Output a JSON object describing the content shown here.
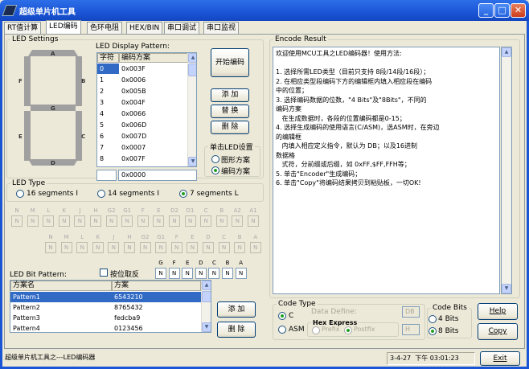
{
  "window": {
    "title": "超级单片机工具"
  },
  "tabs": [
    {
      "label": "RT值计算"
    },
    {
      "label": "LED编码"
    },
    {
      "label": "色环电阻"
    },
    {
      "label": "HEX/BIN"
    },
    {
      "label": "串口调试"
    },
    {
      "label": "串口监视"
    }
  ],
  "led_settings": {
    "legend": "LED Settings",
    "segments": [
      "A",
      "F",
      "B",
      "G",
      "E",
      "C",
      "D"
    ]
  },
  "display_pattern": {
    "legend": "LED Display Pattern:",
    "columns": [
      "字符",
      "编码方案"
    ],
    "rows": [
      {
        "char": "0",
        "code": "0x003F"
      },
      {
        "char": "1",
        "code": "0x0006"
      },
      {
        "char": "2",
        "code": "0x005B"
      },
      {
        "char": "3",
        "code": "0x004F"
      },
      {
        "char": "4",
        "code": "0x0066"
      },
      {
        "char": "5",
        "code": "0x006D"
      },
      {
        "char": "6",
        "code": "0x007D"
      },
      {
        "char": "7",
        "code": "0x0007"
      },
      {
        "char": "8",
        "code": "0x007F"
      }
    ],
    "input_char": "",
    "input_code": "0x0000"
  },
  "buttons": {
    "start": "开始编码",
    "add": "添 加",
    "replace": "替 换",
    "delete": "删 除",
    "add2": "添 加",
    "delete2": "删 除",
    "help": "Help",
    "copy": "Copy",
    "exit": "Exit"
  },
  "single_click": {
    "legend": "单击LED设置",
    "options": [
      "图形方案",
      "编码方案"
    ]
  },
  "led_type": {
    "legend": "LED Type",
    "options": [
      "16 segments I",
      "14 segments I",
      "7 segments L"
    ]
  },
  "bits": {
    "row1": [
      "N",
      "M",
      "L",
      "K",
      "J",
      "H",
      "G2",
      "G1",
      "F",
      "E",
      "D2",
      "D1",
      "C",
      "B",
      "A2",
      "A1"
    ],
    "row2": [
      "N",
      "M",
      "L",
      "K",
      "J",
      "H",
      "G2",
      "G1",
      "F",
      "E",
      "D",
      "C",
      "B",
      "A"
    ],
    "row3": [
      "G",
      "F",
      "E",
      "D",
      "C",
      "B",
      "A"
    ],
    "value": "N"
  },
  "bit_pattern": {
    "legend": "LED Bit Pattern:",
    "reverse_label": "按位取反",
    "columns": [
      "方案名",
      "方案"
    ],
    "rows": [
      {
        "name": "Pattern1",
        "value": "6543210"
      },
      {
        "name": "Pattern2",
        "value": "8765432"
      },
      {
        "name": "Pattern3",
        "value": "fedcba9"
      },
      {
        "name": "Pattern4",
        "value": "0123456"
      }
    ]
  },
  "encode_result": {
    "legend": "Encode Result",
    "lines": [
      "欢迎使用MCU工具之LED编码器！使用方法:",
      "",
      "1. 选择所需LED类型（目前只支持 8段/14段/16段）；",
      "2. 在相应类型段编码下方的编辑框内填入相应段在编码",
      "中的位置；",
      "3. 选择编码数据的位数，\"4 Bits\"及\"8Bits\"，不同的",
      "编码方案",
      "   在生成数据时，各段的位置编码都是0-15；",
      "4. 选择生成编码的使用语言(C/ASM)，选ASM时，在旁边",
      "的编辑框",
      "   内填入相应定义指令，默认为 DB；以及16进制",
      "数据格",
      "   式符，分前缀或后缀，如 0xFF,$FF,FFH等；",
      "5. 单击\"Encoder\"生成编码；",
      "6. 单击\"Copy\"将编码结果拷贝到粘贴板，一切OK!"
    ]
  },
  "code_type": {
    "legend": "Code Type",
    "options": [
      "C",
      "ASM"
    ],
    "data_define_label": "Data Define:",
    "data_define_value": "DB",
    "hex_express": "Hex Express",
    "hex_options": [
      "Prefix",
      "Postfix"
    ],
    "hex_value": "H"
  },
  "code_bits": {
    "legend": "Code Bits",
    "options": [
      "4 Bits",
      "8 Bits"
    ]
  },
  "status": {
    "left": "超级单片机工具之---LED编码器",
    "date": "3-4-27",
    "time": "下午 03:01:23"
  }
}
